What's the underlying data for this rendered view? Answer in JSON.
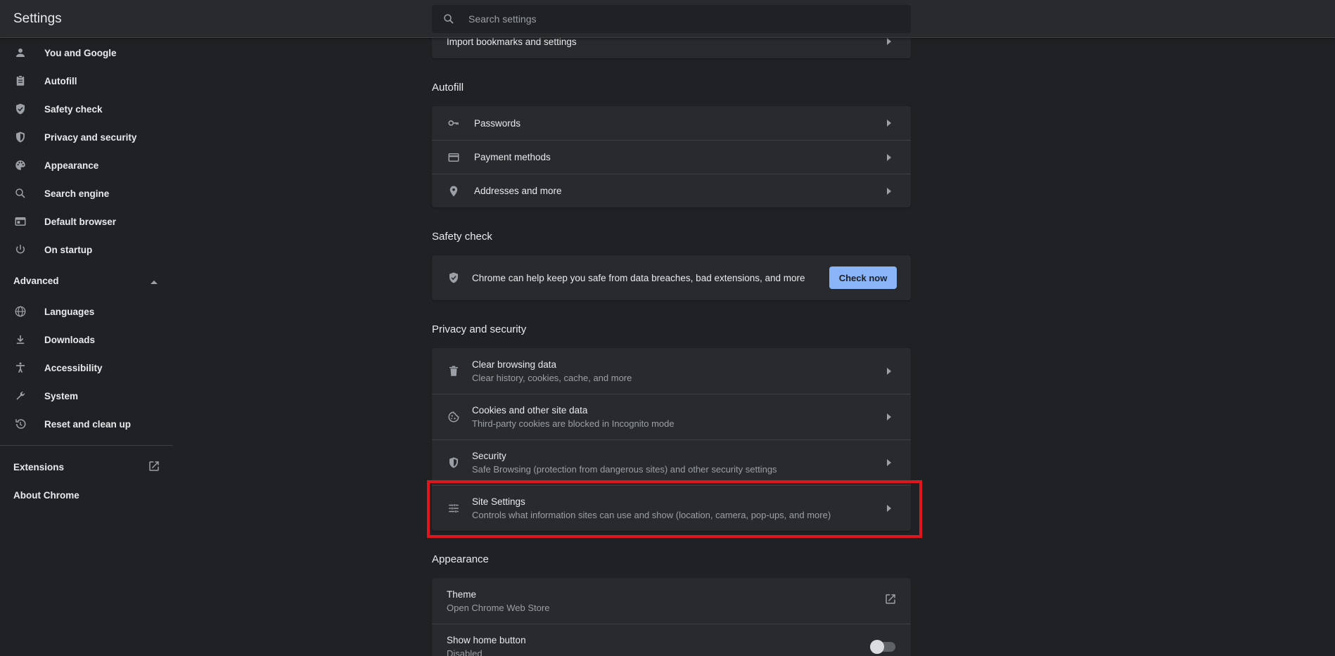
{
  "header": {
    "title": "Settings",
    "search_placeholder": "Search settings"
  },
  "sidebar": {
    "items": [
      {
        "label": "You and Google",
        "icon": "person-icon"
      },
      {
        "label": "Autofill",
        "icon": "clipboard-icon"
      },
      {
        "label": "Safety check",
        "icon": "shield-check-icon"
      },
      {
        "label": "Privacy and security",
        "icon": "shield-half-icon"
      },
      {
        "label": "Appearance",
        "icon": "palette-icon"
      },
      {
        "label": "Search engine",
        "icon": "search-icon"
      },
      {
        "label": "Default browser",
        "icon": "browser-icon"
      },
      {
        "label": "On startup",
        "icon": "power-icon"
      }
    ],
    "advanced_label": "Advanced",
    "advanced_items": [
      {
        "label": "Languages",
        "icon": "globe-icon"
      },
      {
        "label": "Downloads",
        "icon": "download-icon"
      },
      {
        "label": "Accessibility",
        "icon": "accessibility-icon"
      },
      {
        "label": "System",
        "icon": "wrench-icon"
      },
      {
        "label": "Reset and clean up",
        "icon": "restore-icon"
      }
    ],
    "extensions_label": "Extensions",
    "about_label": "About Chrome"
  },
  "main": {
    "import_row": "Import bookmarks and settings",
    "autofill": {
      "title": "Autofill",
      "rows": [
        {
          "label": "Passwords",
          "icon": "key-icon"
        },
        {
          "label": "Payment methods",
          "icon": "credit-card-icon"
        },
        {
          "label": "Addresses and more",
          "icon": "location-pin-icon"
        }
      ]
    },
    "safety": {
      "title": "Safety check",
      "text": "Chrome can help keep you safe from data breaches, bad extensions, and more",
      "button": "Check now"
    },
    "privacy": {
      "title": "Privacy and security",
      "rows": [
        {
          "label": "Clear browsing data",
          "sub": "Clear history, cookies, cache, and more",
          "icon": "trash-icon"
        },
        {
          "label": "Cookies and other site data",
          "sub": "Third-party cookies are blocked in Incognito mode",
          "icon": "cookie-icon"
        },
        {
          "label": "Security",
          "sub": "Safe Browsing (protection from dangerous sites) and other security settings",
          "icon": "shield-half-icon"
        },
        {
          "label": "Site Settings",
          "sub": "Controls what information sites can use and show (location, camera, pop-ups, and more)",
          "icon": "tune-icon"
        }
      ]
    },
    "appearance": {
      "title": "Appearance",
      "theme_label": "Theme",
      "theme_sub": "Open Chrome Web Store",
      "home_label": "Show home button",
      "home_sub": "Disabled"
    }
  },
  "colors": {
    "accent": "#8ab4f8",
    "highlight": "#e0161e",
    "background": "#202124",
    "card": "#292a2d"
  }
}
